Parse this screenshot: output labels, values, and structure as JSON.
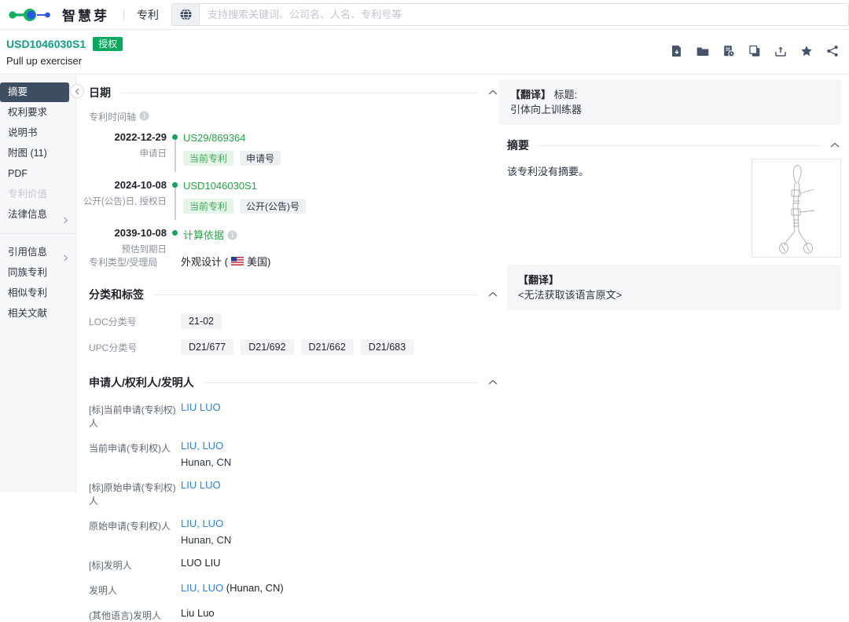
{
  "header": {
    "brand": "智慧芽",
    "nav_patent": "专利",
    "search_placeholder": "支持搜索关键词、公司名、人名、专利号等"
  },
  "title_bar": {
    "patent_number": "USD1046030S1",
    "status_badge": "授权",
    "patent_title": "Pull up exerciser",
    "action_icons": [
      "pdf-download",
      "folder",
      "valuation-report",
      "copy",
      "export",
      "favorite-star",
      "share"
    ]
  },
  "sidebar": {
    "items": [
      {
        "label": "摘要"
      },
      {
        "label": "权利要求"
      },
      {
        "label": "说明书"
      },
      {
        "label": "附图 (11)"
      },
      {
        "label": "PDF"
      },
      {
        "label": "专利价值"
      },
      {
        "label": "法律信息"
      },
      {
        "label": "引用信息"
      },
      {
        "label": "同族专利"
      },
      {
        "label": "相似专利"
      },
      {
        "label": "相关文献"
      }
    ]
  },
  "main": {
    "date_section": {
      "title": "日期",
      "timeline_label": "专利时间轴",
      "events": [
        {
          "date": "2022-12-29",
          "label": "申请日",
          "value": "US29/869364",
          "tag1": "当前专利",
          "tag2": "申请号"
        },
        {
          "date": "2024-10-08",
          "label": "公开(公告)日, 授权日",
          "value": "USD1046030S1",
          "tag1": "当前专利",
          "tag2": "公开(公告)号"
        },
        {
          "date": "2039-10-08",
          "label": "预估到期日",
          "value": "计算依据"
        }
      ],
      "type_label": "专利类型/受理局",
      "type_value_prefix": "外观设计 (",
      "type_value_suffix": "美国)"
    },
    "classification_section": {
      "title": "分类和标签",
      "loc_label": "LOC分类号",
      "loc_chips": [
        "21-02"
      ],
      "upc_label": "UPC分类号",
      "upc_chips": [
        "D21/677",
        "D21/692",
        "D21/662",
        "D21/683"
      ]
    },
    "people_section": {
      "title": "申请人/权利人/发明人",
      "rows": [
        {
          "label": "[标]当前申请(专利权)人",
          "link": "LIU LUO"
        },
        {
          "label": "当前申请(专利权)人",
          "link": "LIU, LUO",
          "sub": "Hunan, CN"
        },
        {
          "label": "[标]原始申请(专利权)人",
          "link": "LIU LUO"
        },
        {
          "label": "原始申请(专利权)人",
          "link": "LIU, LUO",
          "sub": "Hunan, CN"
        },
        {
          "label": "[标]发明人",
          "text": "LUO LIU"
        },
        {
          "label": "发明人",
          "link": "LIU, LUO",
          "suffix": " (Hunan, CN)"
        },
        {
          "label": "(其他语言)发明人",
          "text": "Liu Luo"
        }
      ]
    }
  },
  "right_panel": {
    "translation_title": {
      "prefix": "【翻译】",
      "label": "标题:",
      "value": "引体向上训练器"
    },
    "abstract": {
      "title": "摘要",
      "empty_text": "该专利没有摘要。"
    },
    "translation_original": {
      "prefix": "【翻译】",
      "value": "<无法获取该语言原文>"
    }
  },
  "colors": {
    "accent_green": "#0aa85e",
    "patent_number_teal": "#0f9f88",
    "timeline_link_green": "#28a348",
    "link_blue": "#2f81d6",
    "selected_nav_bg": "#3d4e63",
    "icon_slate": "#44546f"
  }
}
